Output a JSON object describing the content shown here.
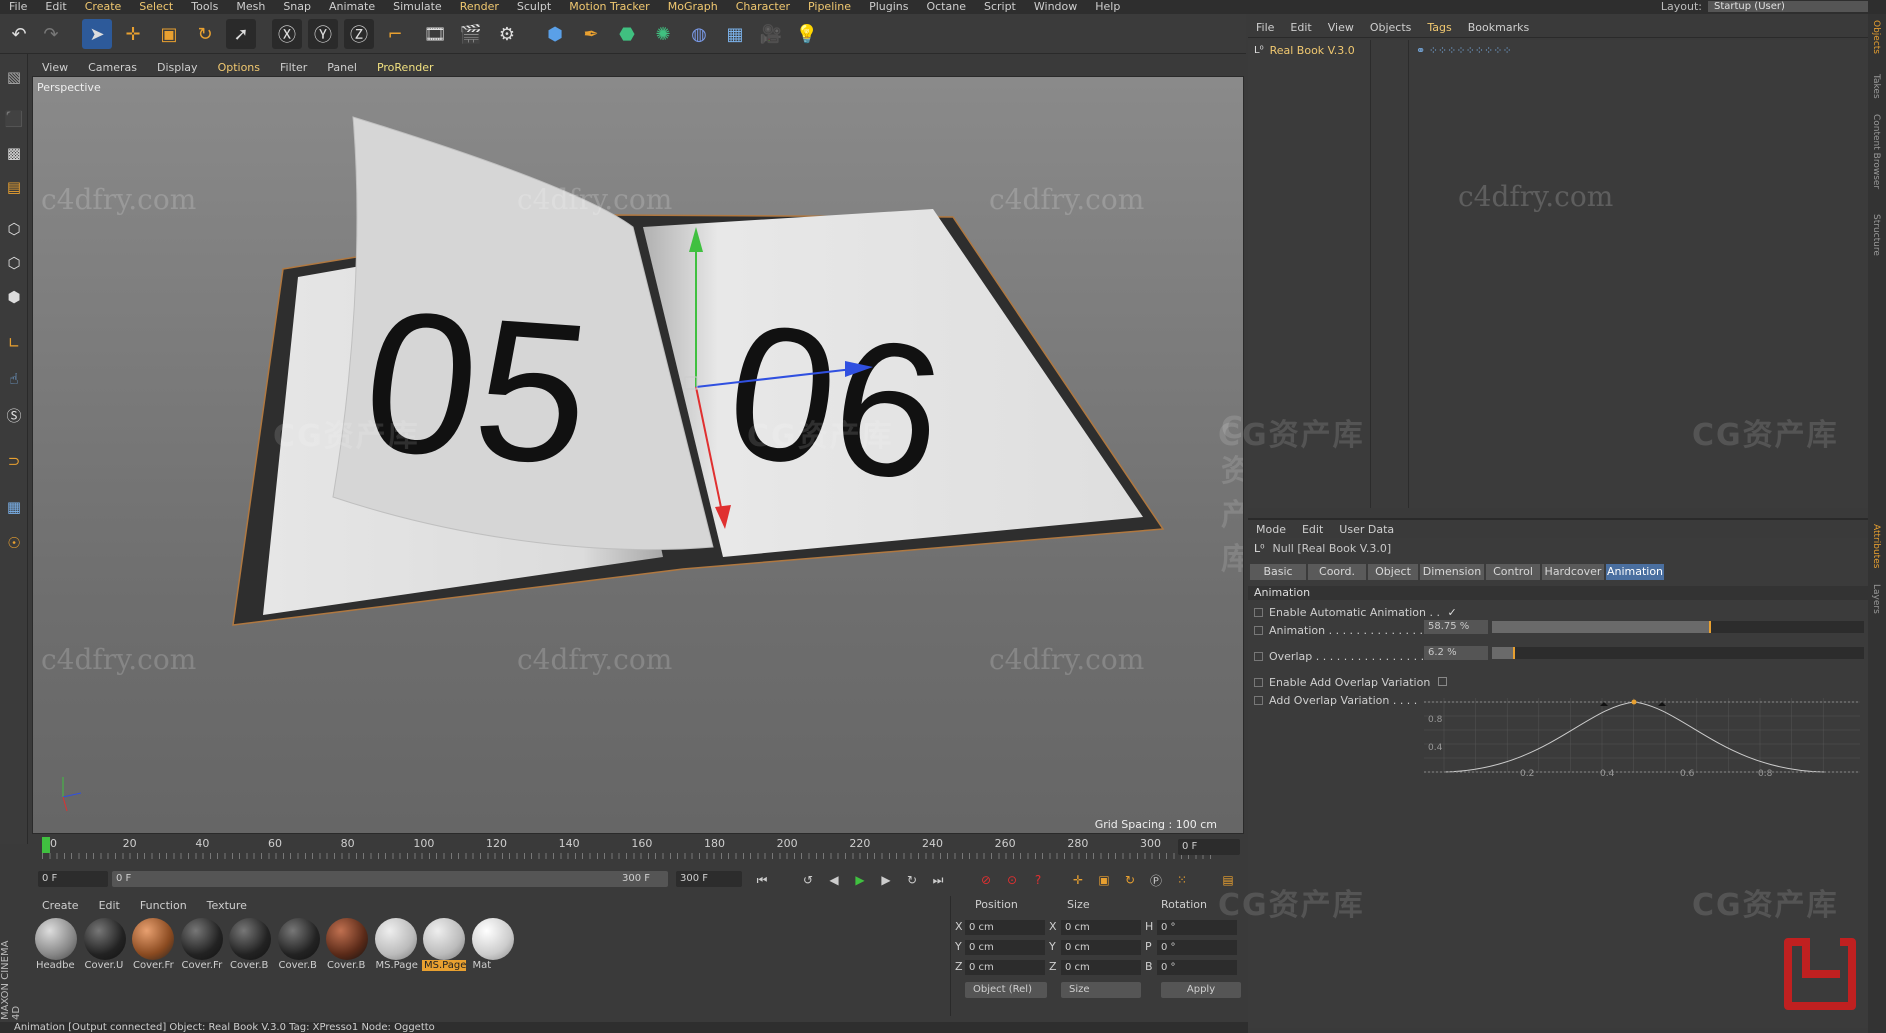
{
  "app": {
    "menu": [
      "File",
      "Edit",
      "Create",
      "Select",
      "Tools",
      "Mesh",
      "Snap",
      "Animate",
      "Simulate",
      "Render",
      "Sculpt",
      "Motion Tracker",
      "MoGraph",
      "Character",
      "Pipeline",
      "Plugins",
      "Octane",
      "Script",
      "Window",
      "Help"
    ],
    "layout_label": "Layout:",
    "layout_value": "Startup (User)"
  },
  "viewport": {
    "menu": [
      "View",
      "Cameras",
      "Display",
      "Options",
      "Filter",
      "Panel",
      "ProRender"
    ],
    "camera_label": "Perspective",
    "grid_spacing": "Grid Spacing : 100 cm",
    "page_left": "05",
    "page_right": "06",
    "watermark": "c4dfry.com",
    "watermark_cg": "CG资产库"
  },
  "timeline": {
    "ticks": [
      "0",
      "20",
      "40",
      "60",
      "80",
      "100",
      "120",
      "140",
      "160",
      "180",
      "200",
      "220",
      "240",
      "260",
      "280",
      "300"
    ],
    "frame_right": "0 F",
    "current_frame": "0 F",
    "range_start": "0 F",
    "range_end": "300 F",
    "end_frame": "300 F"
  },
  "materials": {
    "menu": [
      "Create",
      "Edit",
      "Function",
      "Texture"
    ],
    "items": [
      "Headbe",
      "Cover.U",
      "Cover.Fr",
      "Cover.Fr",
      "Cover.B",
      "Cover.B",
      "Cover.B",
      "MS.Page",
      "MS.Page",
      "Mat"
    ]
  },
  "coordinates": {
    "headers": [
      "Position",
      "Size",
      "Rotation"
    ],
    "rows": [
      {
        "axis": "X",
        "pos": "0 cm",
        "saxis": "X",
        "size": "0 cm",
        "raxis": "H",
        "rot": "0 °"
      },
      {
        "axis": "Y",
        "pos": "0 cm",
        "saxis": "Y",
        "size": "0 cm",
        "raxis": "P",
        "rot": "0 °"
      },
      {
        "axis": "Z",
        "pos": "0 cm",
        "saxis": "Z",
        "size": "0 cm",
        "raxis": "B",
        "rot": "0 °"
      }
    ],
    "mode": "Object (Rel)",
    "size_mode": "Size",
    "apply": "Apply"
  },
  "objects": {
    "menu": [
      "File",
      "Edit",
      "View",
      "Objects",
      "Tags",
      "Bookmarks"
    ],
    "items": [
      {
        "name": "Real Book V.3.0"
      }
    ]
  },
  "attributes": {
    "menu": [
      "Mode",
      "Edit",
      "User Data"
    ],
    "object_title": "Null [Real Book V.3.0]",
    "tabs": [
      "Basic",
      "Coord.",
      "Object",
      "Dimension",
      "Control",
      "Hardcover",
      "Animation"
    ],
    "active_tab": "Animation",
    "section": "Animation",
    "enable_auto_label": "Enable Automatic Animation . .",
    "enable_auto_check": "✓",
    "animation_label": "Animation . . . . . . . . . . . . . . .",
    "animation_value": "58.75 %",
    "animation_fraction": 0.5875,
    "overlap_label": "Overlap . . . . . . . . . . . . . . . . .",
    "overlap_value": "6.2 %",
    "overlap_fraction": 0.062,
    "enable_overlap_var_label": "Enable Add Overlap Variation",
    "add_overlap_var_label": "Add Overlap Variation . . . .",
    "curve_y_labels": [
      "0.8",
      "0.4"
    ],
    "curve_x_labels": [
      "0.2",
      "0.4",
      "0.6",
      "0.8"
    ]
  },
  "status": "Animation [Output connected] Object: Real Book V.3.0 Tag: XPresso1 Node: Oggetto",
  "right_tabs": [
    "Objects",
    "Takes",
    "Content Browser",
    "Structure",
    "Attributes",
    "Layers"
  ],
  "brand": "MAXON CINEMA 4D"
}
